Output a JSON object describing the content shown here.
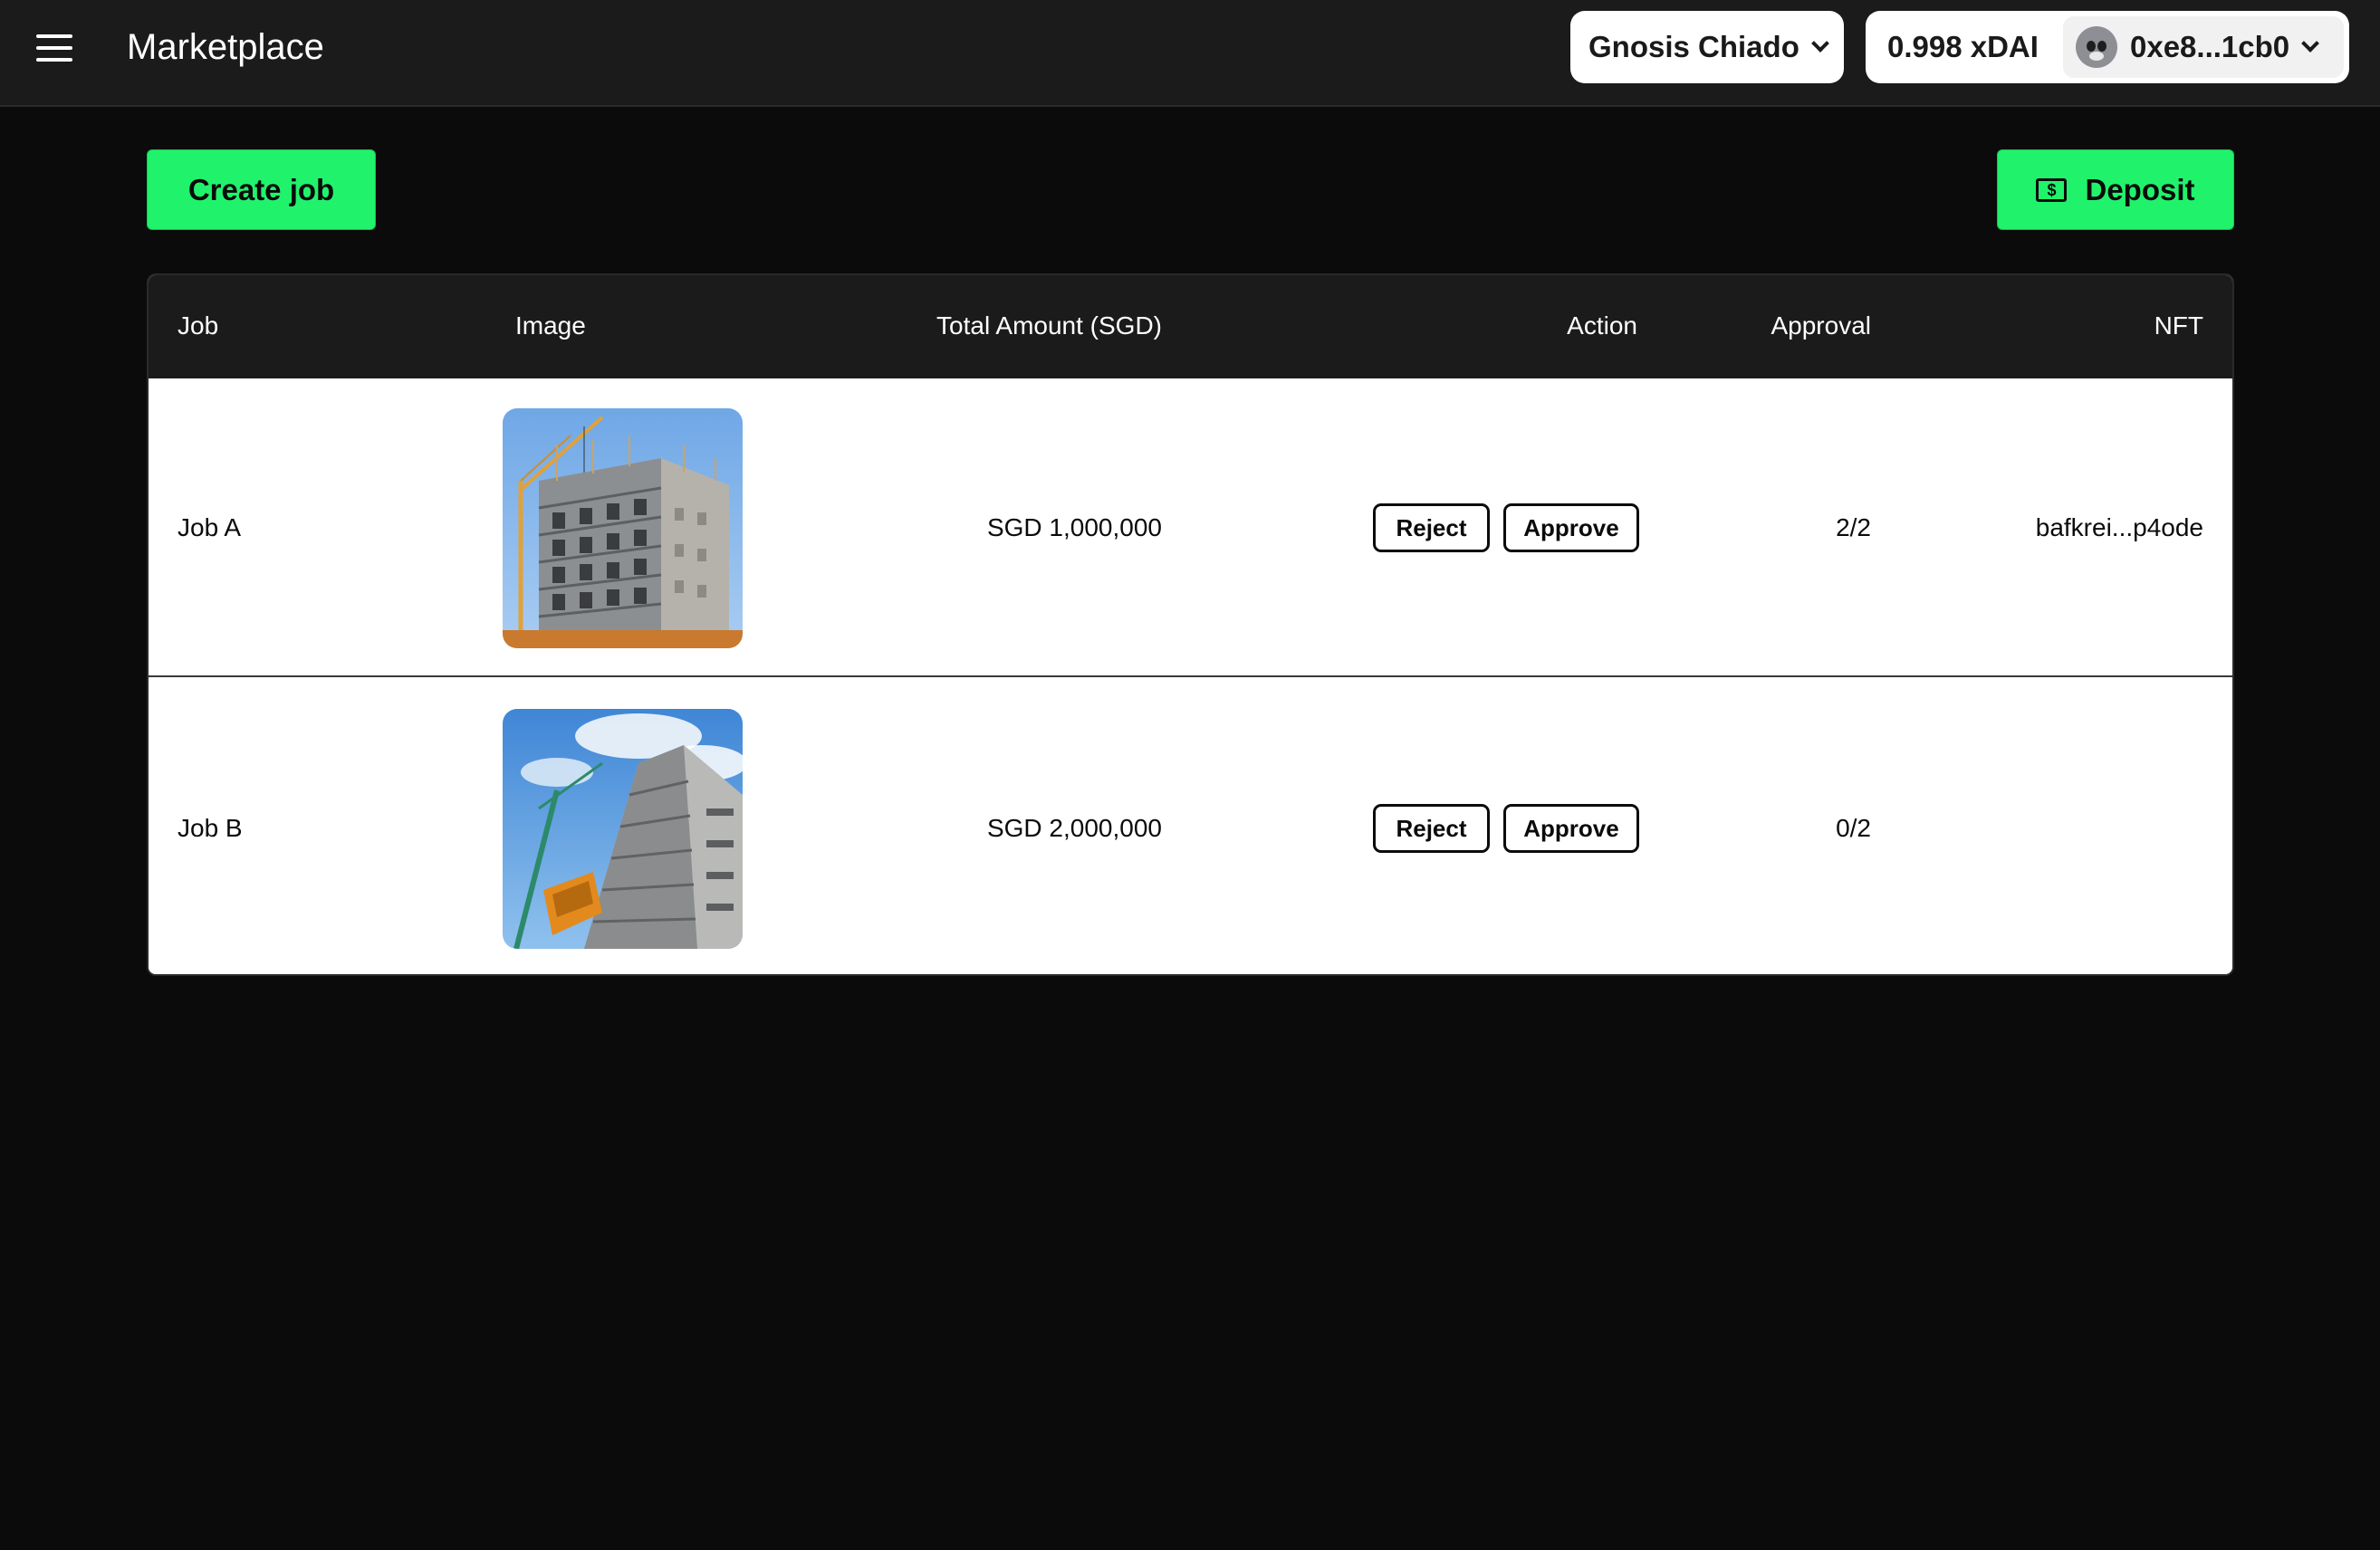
{
  "header": {
    "title": "Marketplace",
    "menu_icon": "hamburger-menu-icon",
    "network": "Gnosis Chiado",
    "balance": "0.998 xDAI",
    "account": "0xe8...1cb0"
  },
  "toolbar": {
    "create_label": "Create job",
    "deposit_label": "Deposit",
    "deposit_icon": "dollar-bill-icon"
  },
  "table": {
    "columns": [
      "Job",
      "Image",
      "Total Amount (SGD)",
      "Action",
      "Approval",
      "NFT"
    ],
    "rows": [
      {
        "job": "Job A",
        "image": "construction-building-photo",
        "amount": "SGD 1,000,000",
        "reject_label": "Reject",
        "approve_label": "Approve",
        "approval": "2/2",
        "nft": "bafkrei...p4ode"
      },
      {
        "job": "Job B",
        "image": "building-crane-sky-photo",
        "amount": "SGD 2,000,000",
        "reject_label": "Reject",
        "approve_label": "Approve",
        "approval": "0/2",
        "nft": ""
      }
    ]
  },
  "colors": {
    "accent": "#20f36b",
    "background": "#0b0b0b",
    "header_bg": "#1b1b1b"
  }
}
